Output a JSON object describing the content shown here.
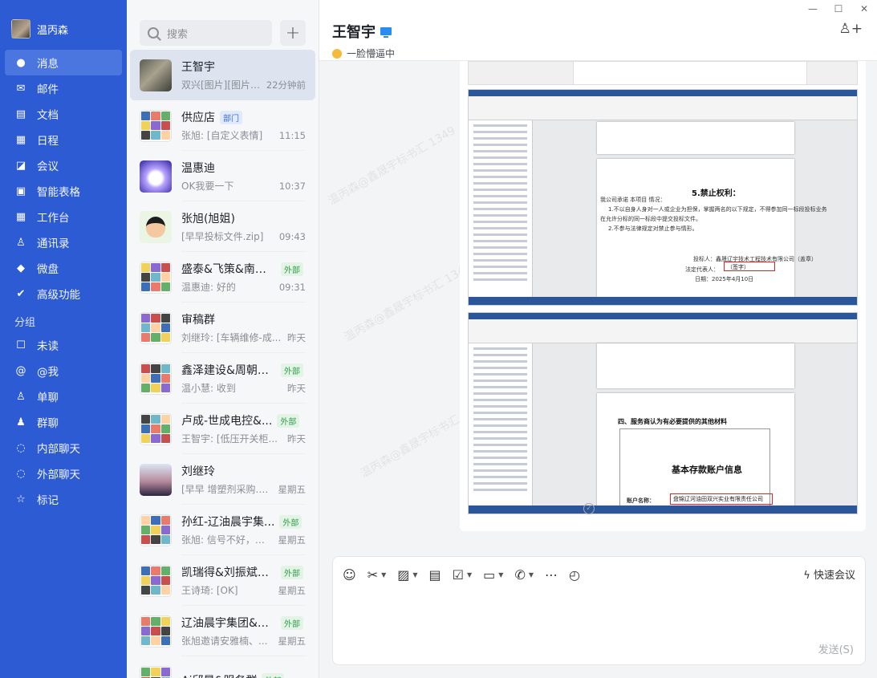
{
  "user": {
    "name": "温丙森"
  },
  "nav": {
    "items": [
      {
        "label": "消息",
        "icon": "chat-bubble-icon",
        "glyph": "●"
      },
      {
        "label": "邮件",
        "icon": "mail-icon",
        "glyph": "✉"
      },
      {
        "label": "文档",
        "icon": "document-icon",
        "glyph": "▤"
      },
      {
        "label": "日程",
        "icon": "calendar-icon",
        "glyph": "▦"
      },
      {
        "label": "会议",
        "icon": "meeting-icon",
        "glyph": "◪"
      },
      {
        "label": "智能表格",
        "icon": "smart-table-icon",
        "glyph": "▣"
      },
      {
        "label": "工作台",
        "icon": "workbench-icon",
        "glyph": "▦"
      },
      {
        "label": "通讯录",
        "icon": "contacts-icon",
        "glyph": "♙"
      },
      {
        "label": "微盘",
        "icon": "cloud-drive-icon",
        "glyph": "◆"
      },
      {
        "label": "高级功能",
        "icon": "advanced-icon",
        "glyph": "✔"
      }
    ],
    "group_title": "分组",
    "groups": [
      {
        "label": "未读",
        "icon": "unread-icon",
        "glyph": "☐"
      },
      {
        "label": "@我",
        "icon": "mention-icon",
        "glyph": "@"
      },
      {
        "label": "单聊",
        "icon": "single-chat-icon",
        "glyph": "♙"
      },
      {
        "label": "群聊",
        "icon": "group-chat-icon",
        "glyph": "♟"
      },
      {
        "label": "内部聊天",
        "icon": "internal-chat-icon",
        "glyph": "◌"
      },
      {
        "label": "外部聊天",
        "icon": "external-chat-icon",
        "glyph": "◌"
      },
      {
        "label": "标记",
        "icon": "star-icon",
        "glyph": "☆"
      }
    ]
  },
  "search": {
    "placeholder": "搜索"
  },
  "conversations": [
    {
      "name": "王智宇",
      "preview": "双兴[图片][图片]...",
      "time": "22分钟前",
      "avatar": "photo"
    },
    {
      "name": "供应店",
      "tag": "部门",
      "tag_type": "dept",
      "preview": "张旭: [自定义表情]",
      "time": "11:15",
      "avatar": "grid"
    },
    {
      "name": "温惠迪",
      "preview": "OK我要一下",
      "time": "10:37",
      "avatar": "star"
    },
    {
      "name": "张旭(旭姐)",
      "preview": "[早早投标文件.zip]",
      "time": "09:43",
      "avatar": "cartoon"
    },
    {
      "name": "盛泰&飞策&南君...",
      "tag": "外部",
      "tag_type": "ext",
      "preview": "温惠迪: 好的",
      "time": "09:31",
      "avatar": "grid"
    },
    {
      "name": "审稿群",
      "preview": "刘继玲: [车辆维修-成...",
      "time": "昨天",
      "avatar": "grid"
    },
    {
      "name": "鑫泽建设&周朝东...",
      "tag": "外部",
      "tag_type": "ext",
      "preview": "温小慧: 收到",
      "time": "昨天",
      "avatar": "grid"
    },
    {
      "name": "卢成-世成电控&...",
      "tag": "外部",
      "tag_type": "ext",
      "preview": "王智宇: [低压开关柜...",
      "time": "昨天",
      "avatar": "grid"
    },
    {
      "name": "刘继玲",
      "preview": "[早早 增塑剂采购.d...",
      "time": "星期五",
      "avatar": "girl"
    },
    {
      "name": "孙红-辽油晨宇集...",
      "tag": "外部",
      "tag_type": "ext",
      "preview": "张旭: 信号不好，总...",
      "time": "星期五",
      "avatar": "grid"
    },
    {
      "name": "凯瑞得&刘振斌&...",
      "tag": "外部",
      "tag_type": "ext",
      "preview": "王诗琦: [OK]",
      "time": "星期五",
      "avatar": "grid"
    },
    {
      "name": "辽油晨宇集团&孙...",
      "tag": "外部",
      "tag_type": "ext",
      "preview": "张旭邀请安雅楠、...",
      "time": "星期五",
      "avatar": "grid"
    },
    {
      "name": "Ai邱晨&服务群",
      "tag": "外部",
      "tag_type": "ext",
      "preview": "",
      "time": "",
      "avatar": "grid"
    }
  ],
  "chat": {
    "peer_name": "王智宇",
    "status": "一脸懵逼中",
    "quick_meeting": "快速会议",
    "send_label": "发送(S)",
    "watermark": "温丙森@鑫晟宇标书汇 1349"
  },
  "doc1": {
    "heading": "5.禁止权利：",
    "line1": "我公司承诺 本项目 情况：",
    "line2": "1.不以自身人身对一人或企业为担保，掌握两名的以下规定，不得参加同一标段投标业务",
    "line3": "在允许分标的同一标段中提交投标文件。",
    "line4": "2.不参与法律规定对禁止参与情形。",
    "signer": "投标人：鑫晟辽宇技术工程技术有限公司（盖章）",
    "legal_rep": "法定代表人：",
    "stamp_text": "（签字）",
    "date": "日期：2025年4月10日"
  },
  "doc2": {
    "heading": "四、服务商认为有必要提供的其他材料",
    "title": "基本存款账户信息",
    "field_label": "账户名称：",
    "field_value": "盘锦辽河油田双兴实业有限责任公司"
  }
}
